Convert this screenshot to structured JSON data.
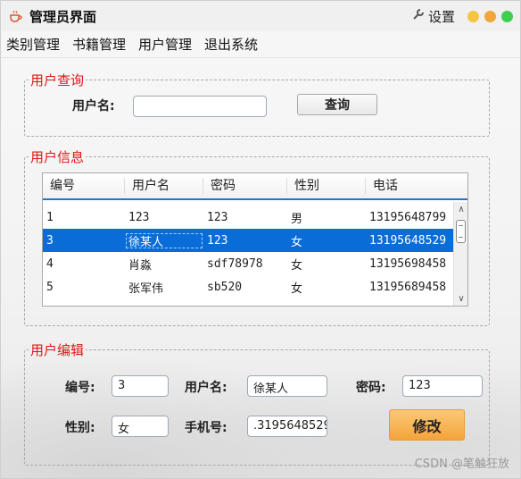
{
  "window": {
    "title": "管理员界面",
    "settings_label": "设置"
  },
  "menu": [
    "类别管理",
    "书籍管理",
    "用户管理",
    "退出系统"
  ],
  "query": {
    "legend": "用户查询",
    "username_label": "用户名:",
    "username_value": "",
    "search_button": "查询"
  },
  "info": {
    "legend": "用户信息",
    "columns": [
      "编号",
      "用户名",
      "密码",
      "性别",
      "电话"
    ],
    "rows": [
      [
        "1",
        "123",
        "123",
        "男",
        "13195648799"
      ],
      [
        "3",
        "徐某人",
        "123",
        "女",
        "13195648529"
      ],
      [
        "4",
        "肖淼",
        "sdf78978",
        "女",
        "13195698458"
      ],
      [
        "5",
        "张军伟",
        "sb520",
        "女",
        "13195689458"
      ]
    ]
  },
  "edit": {
    "legend": "用户编辑",
    "id_label": "编号:",
    "id_value": "3",
    "username_label": "用户名:",
    "username_value": "徐某人",
    "password_label": "密码:",
    "password_value": "123",
    "gender_label": "性别:",
    "gender_value": "女",
    "phone_label": "手机号:",
    "phone_value": ".3195648529",
    "modify_button": "修改"
  },
  "watermark": "CSDN @笔触狂放",
  "colors": {
    "legend": "#e01818",
    "selection": "#0a6cd6",
    "modify_button": "#f4a43b"
  }
}
